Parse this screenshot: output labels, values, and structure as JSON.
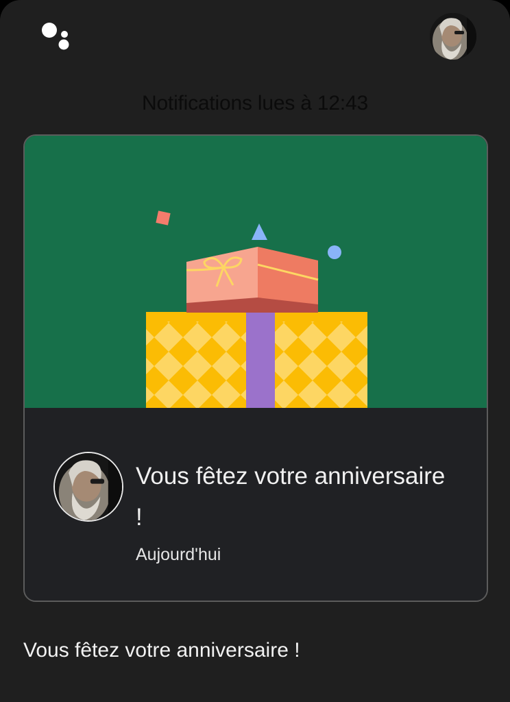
{
  "header": {
    "logo_icon": "google-assistant-dots-icon",
    "profile_avatar": "user-avatar"
  },
  "status": {
    "read_text": "Notifications lues à 12:43"
  },
  "card": {
    "banner_illustration": "birthday-gifts",
    "title": "Vous fêtez votre anniversaire !",
    "date": "Aujourd'hui"
  },
  "message": {
    "text": "Vous fêtez votre anniversaire !"
  },
  "colors": {
    "background": "#1f1f1f",
    "banner": "#17704a",
    "card_border": "#5c5c5c"
  }
}
